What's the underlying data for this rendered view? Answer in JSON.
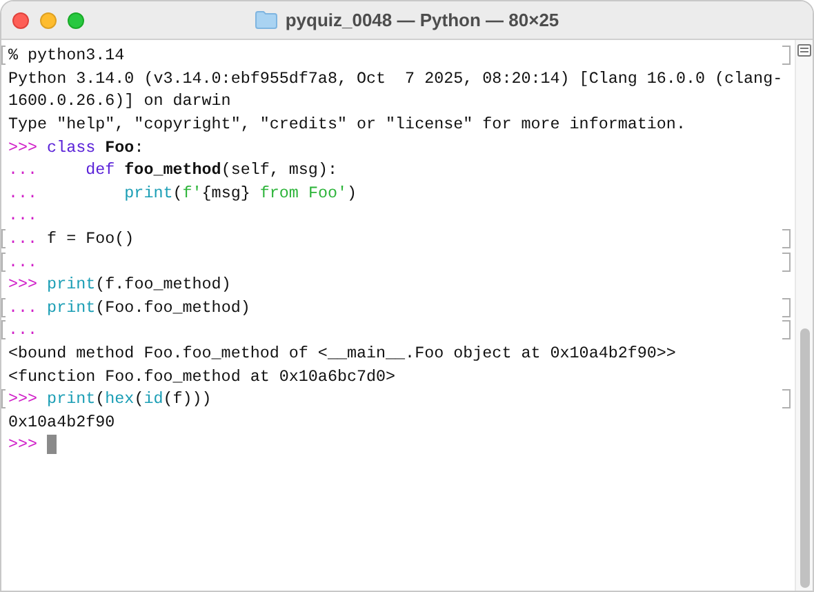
{
  "window": {
    "title": "pyquiz_0048 — Python — 80×25"
  },
  "lines": [
    {
      "marked": true,
      "cursor": false,
      "segments": [
        {
          "kind": "plain",
          "text": "% python3.14"
        }
      ]
    },
    {
      "marked": false,
      "cursor": false,
      "segments": [
        {
          "kind": "plain",
          "text": "Python 3.14.0 (v3.14.0:ebf955df7a8, Oct  7 2025, 08:20:14) [Clang 16.0.0 (clang-"
        }
      ]
    },
    {
      "marked": false,
      "cursor": false,
      "segments": [
        {
          "kind": "plain",
          "text": "1600.0.26.6)] on darwin"
        }
      ]
    },
    {
      "marked": false,
      "cursor": false,
      "segments": [
        {
          "kind": "plain",
          "text": "Type \"help\", \"copyright\", \"credits\" or \"license\" for more information."
        }
      ]
    },
    {
      "marked": false,
      "cursor": false,
      "segments": [
        {
          "kind": "prompt",
          "text": ">>>"
        },
        {
          "kind": "keyword",
          "text": " class"
        },
        {
          "kind": "name",
          "text": " Foo"
        },
        {
          "kind": "plain",
          "text": ":"
        }
      ]
    },
    {
      "marked": false,
      "cursor": false,
      "segments": [
        {
          "kind": "prompt",
          "text": "..."
        },
        {
          "kind": "keyword",
          "text": "     def"
        },
        {
          "kind": "name",
          "text": " foo_method"
        },
        {
          "kind": "plain",
          "text": "(self, msg):"
        }
      ]
    },
    {
      "marked": false,
      "cursor": false,
      "segments": [
        {
          "kind": "prompt",
          "text": "..."
        },
        {
          "kind": "builtin",
          "text": "         print"
        },
        {
          "kind": "plain",
          "text": "("
        },
        {
          "kind": "string",
          "text": "f'"
        },
        {
          "kind": "plain",
          "text": "{msg}"
        },
        {
          "kind": "string",
          "text": " from Foo'"
        },
        {
          "kind": "plain",
          "text": ")"
        }
      ]
    },
    {
      "marked": false,
      "cursor": false,
      "segments": [
        {
          "kind": "prompt",
          "text": "..."
        }
      ]
    },
    {
      "marked": true,
      "cursor": false,
      "segments": [
        {
          "kind": "prompt",
          "text": "..."
        },
        {
          "kind": "plain",
          "text": " f = Foo()"
        }
      ]
    },
    {
      "marked": true,
      "cursor": false,
      "segments": [
        {
          "kind": "prompt",
          "text": "..."
        }
      ]
    },
    {
      "marked": false,
      "cursor": false,
      "segments": [
        {
          "kind": "prompt",
          "text": ">>>"
        },
        {
          "kind": "builtin",
          "text": " print"
        },
        {
          "kind": "plain",
          "text": "(f.foo_method)"
        }
      ]
    },
    {
      "marked": true,
      "cursor": false,
      "segments": [
        {
          "kind": "prompt",
          "text": "..."
        },
        {
          "kind": "builtin",
          "text": " print"
        },
        {
          "kind": "plain",
          "text": "(Foo.foo_method)"
        }
      ]
    },
    {
      "marked": true,
      "cursor": false,
      "segments": [
        {
          "kind": "prompt",
          "text": "..."
        }
      ]
    },
    {
      "marked": false,
      "cursor": false,
      "segments": [
        {
          "kind": "plain",
          "text": "<bound method Foo.foo_method of <__main__.Foo object at 0x10a4b2f90>>"
        }
      ]
    },
    {
      "marked": false,
      "cursor": false,
      "segments": [
        {
          "kind": "plain",
          "text": "<function Foo.foo_method at 0x10a6bc7d0>"
        }
      ]
    },
    {
      "marked": true,
      "cursor": false,
      "segments": [
        {
          "kind": "prompt",
          "text": ">>>"
        },
        {
          "kind": "builtin",
          "text": " print"
        },
        {
          "kind": "plain",
          "text": "("
        },
        {
          "kind": "builtin",
          "text": "hex"
        },
        {
          "kind": "plain",
          "text": "("
        },
        {
          "kind": "builtin",
          "text": "id"
        },
        {
          "kind": "plain",
          "text": "(f)))"
        }
      ]
    },
    {
      "marked": false,
      "cursor": false,
      "segments": [
        {
          "kind": "plain",
          "text": "0x10a4b2f90"
        }
      ]
    },
    {
      "marked": false,
      "cursor": true,
      "segments": [
        {
          "kind": "prompt",
          "text": ">>>"
        }
      ]
    }
  ]
}
